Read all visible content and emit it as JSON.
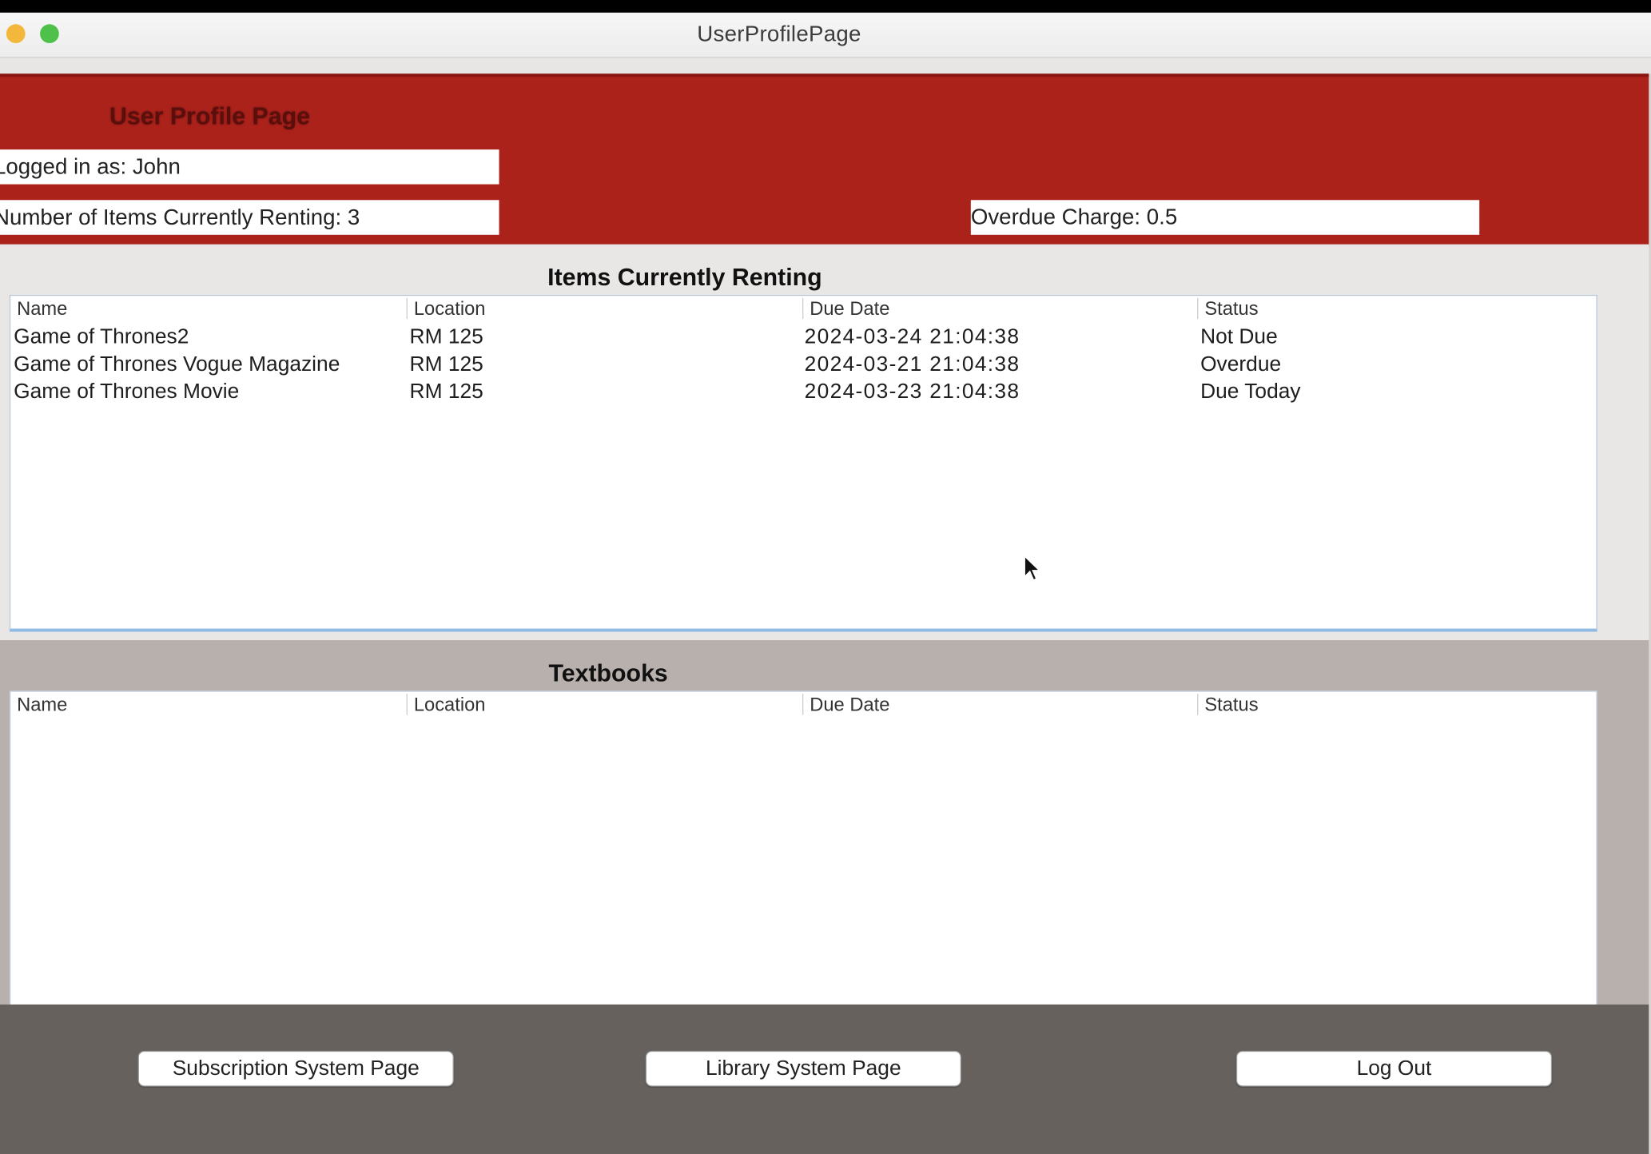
{
  "window": {
    "title": "UserProfilePage"
  },
  "header": {
    "heading": "User Profile Page",
    "logged_in": "Logged in as: John",
    "items_count": "Number of Items Currently Renting: 3",
    "overdue_charge": "Overdue Charge: 0.5"
  },
  "rented": {
    "title": "Items Currently Renting",
    "columns": [
      "Name",
      "Location",
      "Due Date",
      "Status"
    ],
    "rows": [
      {
        "name": "Game of Thrones2",
        "location": "RM 125",
        "due": "2024-03-24 21:04:38",
        "status": "Not Due"
      },
      {
        "name": "Game of Thrones Vogue Magazine",
        "location": "RM 125",
        "due": "2024-03-21 21:04:38",
        "status": "Overdue"
      },
      {
        "name": "Game of Thrones Movie",
        "location": "RM 125",
        "due": "2024-03-23 21:04:38",
        "status": "Due Today"
      }
    ]
  },
  "textbooks": {
    "title": "Textbooks",
    "columns": [
      "Name",
      "Location",
      "Due Date",
      "Status"
    ],
    "rows": []
  },
  "footer": {
    "subscription_button": "Subscription System Page",
    "library_button": "Library System Page",
    "logout_button": "Log Out"
  },
  "colors": {
    "header_red": "#ab221b",
    "footer_gray": "#67615e",
    "textbook_panel": "#b8b0ad"
  }
}
